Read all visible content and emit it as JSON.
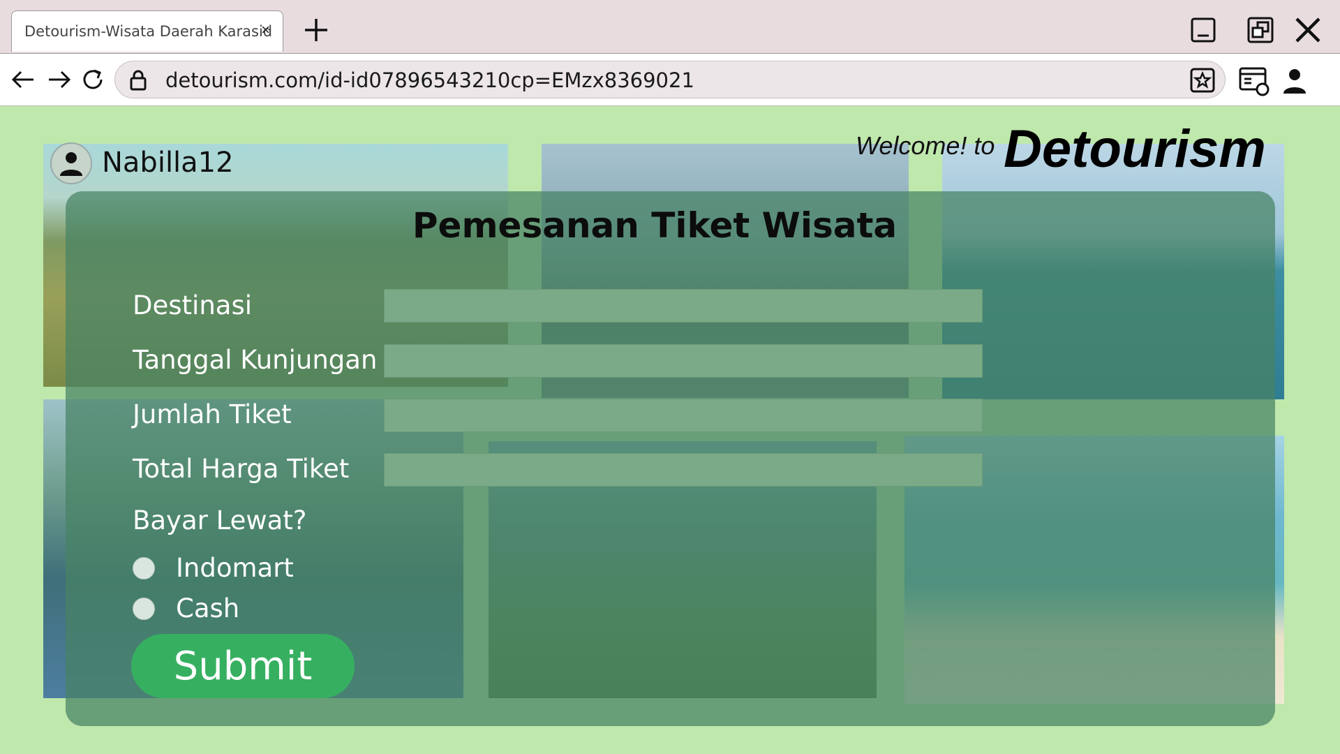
{
  "browser": {
    "tab_title": "Detourism-Wisata Daerah Karasid",
    "tab_close": "×",
    "url": "detourism.com/id-id07896543210cp=EMzx8369021"
  },
  "header": {
    "username": "Nabilla12",
    "welcome": "Welcome! to",
    "brand": "Detourism"
  },
  "form": {
    "title": "Pemesanan Tiket Wisata",
    "fields": [
      {
        "label": "Destinasi",
        "value": ""
      },
      {
        "label": "Tanggal Kunjungan",
        "value": ""
      },
      {
        "label": "Jumlah Tiket",
        "value": ""
      },
      {
        "label": "Total Harga Tiket",
        "value": ""
      }
    ],
    "payment_question": "Bayar Lewat?",
    "payment_options": [
      "Indomart",
      "Cash"
    ],
    "submit_label": "Submit"
  },
  "colors": {
    "page_background": "#bfe8ac",
    "form_overlay": "#46826480",
    "submit_button": "#36b060"
  }
}
